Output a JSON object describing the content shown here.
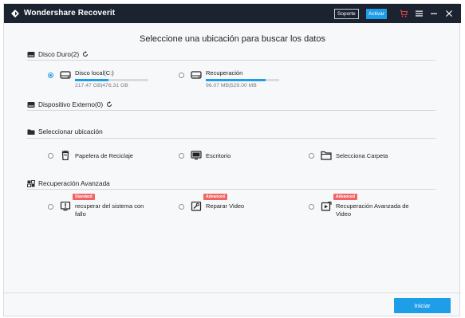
{
  "titlebar": {
    "title": "Wondershare Recoverit",
    "support_label": "Soporte",
    "activate_label": "Activar",
    "icons": [
      "recoverit-logo-icon",
      "cart-icon",
      "menu-icon",
      "minimize-icon",
      "close-icon"
    ],
    "cart_color": "#e8453c"
  },
  "main": {
    "heading": "Seleccione una ubicación para buscar los datos"
  },
  "hard_disk": {
    "title": "Disco Duro(2)",
    "drives": [
      {
        "name": "Disco local(C:)",
        "usage": "217.47 GB|476.31 GB",
        "used_fraction": 0.46,
        "selected": true
      },
      {
        "name": "Recuperación",
        "usage": "96.07 MB|529.00 MB",
        "used_fraction": 0.82,
        "selected": false
      }
    ]
  },
  "external": {
    "title": "Dispositivo Externo(0)"
  },
  "location": {
    "title": "Seleccionar ubicación",
    "options": [
      {
        "label": "Papelera de Reciclaje"
      },
      {
        "label": "Escritorio"
      },
      {
        "label": "Selecciona Carpeta"
      }
    ]
  },
  "advanced": {
    "title": "Recuperación Avanzada",
    "options": [
      {
        "badge": "Standard",
        "label": "recuperar del sistema con fallo"
      },
      {
        "badge": "Advanced",
        "label": "Reparar Video"
      },
      {
        "badge": "Advanced",
        "label": "Recuperación Avanzada de Video"
      }
    ]
  },
  "footer": {
    "start_label": "Iniciar"
  },
  "colors": {
    "accent": "#1f9ee8",
    "titlebar": "#1b2230",
    "badge": "#f06466"
  }
}
